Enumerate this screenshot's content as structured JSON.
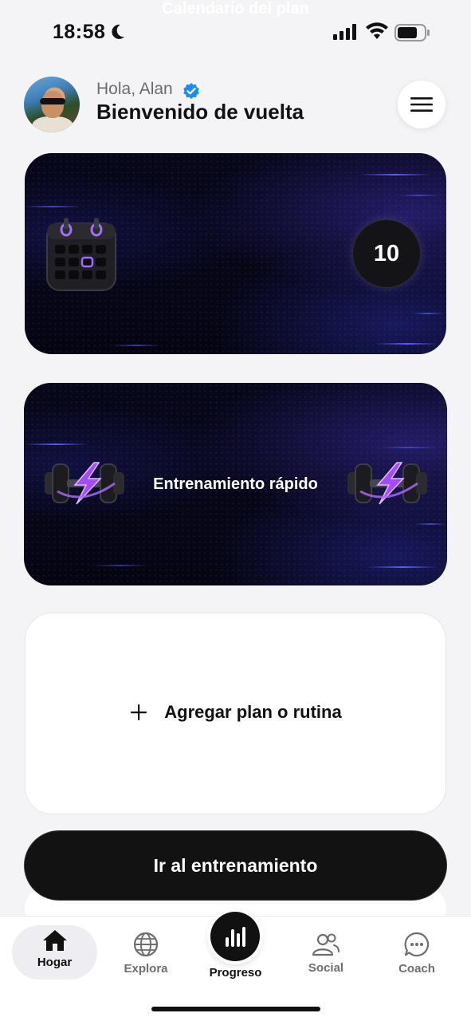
{
  "status_bar": {
    "time": "18:58",
    "icons": [
      "moon-icon",
      "signal-icon",
      "wifi-icon",
      "battery-icon"
    ]
  },
  "header": {
    "greeting": "Hola, Alan",
    "welcome": "Bienvenido de vuelta",
    "icons": [
      "verified-icon",
      "menu-icon"
    ]
  },
  "cards": {
    "calendar": {
      "title": "Calendario del plan",
      "count": "10",
      "icon": "calendar-icon"
    },
    "quick_workout": {
      "title": "Entrenamiento rápido",
      "icon": "dumbbell-icon"
    },
    "add_plan": {
      "label": "Agregar plan o rutina",
      "icon": "plus-icon"
    }
  },
  "go_button": {
    "label": "Ir al entrenamiento"
  },
  "tab_bar": {
    "tabs": [
      {
        "label": "Hogar",
        "icon": "home-icon",
        "active": true
      },
      {
        "label": "Explora",
        "icon": "globe-icon"
      },
      {
        "label": "Progreso",
        "icon": "bar-chart-icon"
      },
      {
        "label": "Social",
        "icon": "people-icon"
      },
      {
        "label": "Coach",
        "icon": "chat-icon"
      }
    ]
  },
  "colors": {
    "background": "#f4f4f6",
    "dark_card": "#06061a",
    "accent_purple": "#8a4dff",
    "verified_blue": "#1d8cf8",
    "button_dark": "#121212"
  }
}
